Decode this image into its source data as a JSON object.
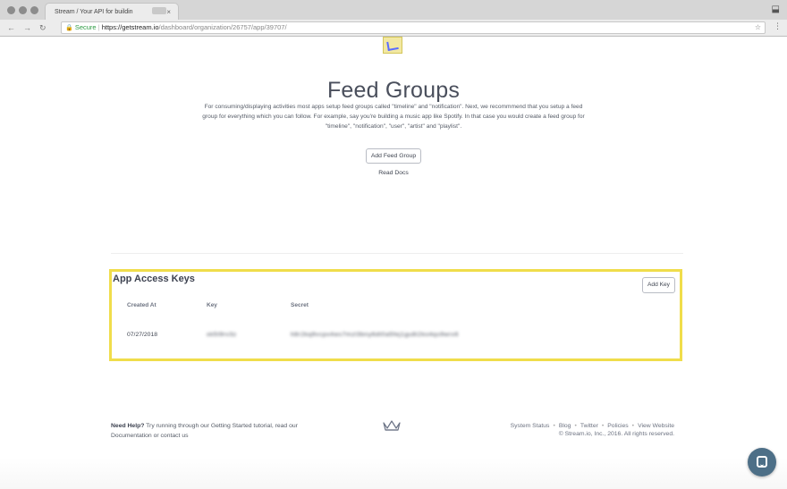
{
  "browser": {
    "tab_title": "Stream / Your API for buildin",
    "tab_close": "×",
    "secure_label": "Secure",
    "url_host": "https://getstream.io",
    "url_path": "/dashboard/organization/26757/app/39707/"
  },
  "page": {
    "title": "Feed Groups",
    "intro": "For consuming/displaying activities most apps setup feed groups called \"timeline\" and \"notification\". Next, we recommmend that you setup a feed group for everything which you can follow. For example, say you're building a music app like Spotify. In that case you would create a feed group for \"timeline\", \"notification\", \"user\", \"artist\" and \"playlist\".",
    "add_feed_group_label": "Add Feed Group",
    "read_docs_label": "Read Docs"
  },
  "keys": {
    "title": "App Access Keys",
    "add_key_label": "Add Key",
    "columns": [
      "Created At",
      "Key",
      "Secret"
    ],
    "rows": [
      {
        "created_at": "07/27/2018",
        "key": "xk5t9rv3z",
        "secret": "h8r2kq9vcpx4ws7mzl3bny6dt0a5fej1gu8i2ko4qs9wrx6"
      }
    ]
  },
  "footer": {
    "need_help": "Need Help?",
    "help_text_1": "Try running through our Getting Started tutorial, read our",
    "help_text_2": "Documentation or contact us",
    "links": [
      "System Status",
      "Blog",
      "Twitter",
      "Policies",
      "View Website"
    ],
    "copyright": "© Stream.io, Inc., 2016. All rights reserved."
  },
  "colors": {
    "highlight": "#f0dd4b",
    "chat_button": "#4d6f87",
    "secure_green": "#2e9c44"
  },
  "icons": [
    "close-icon",
    "back-arrow-icon",
    "forward-arrow-icon",
    "reload-icon",
    "lock-icon",
    "star-icon",
    "menu-icon",
    "checklist-logo-icon",
    "stream-logo-icon",
    "chat-icon"
  ]
}
